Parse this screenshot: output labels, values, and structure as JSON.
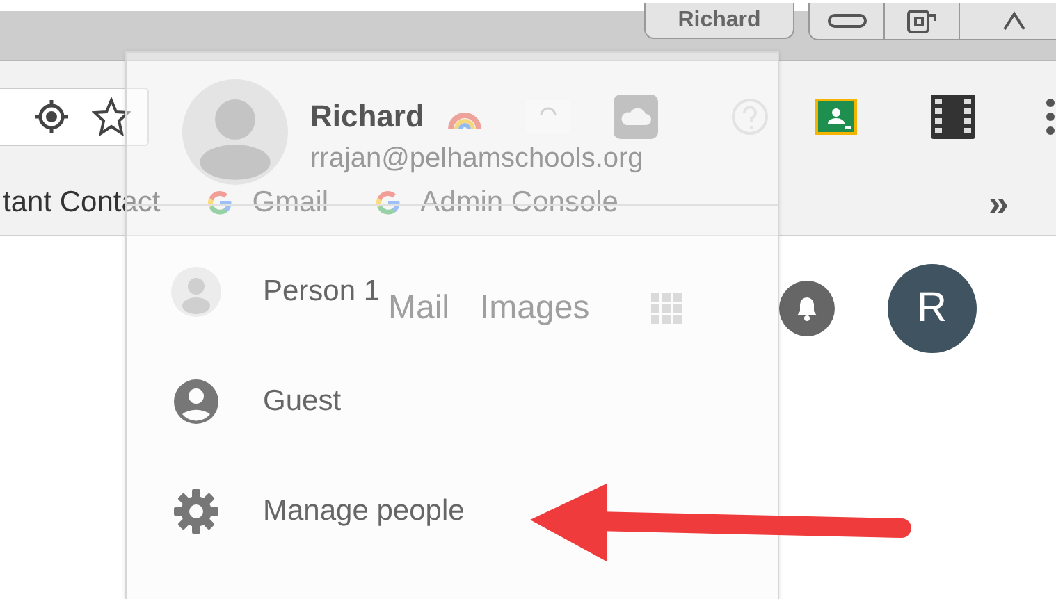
{
  "window": {
    "profile_button": "Richard"
  },
  "bookmarks": [
    {
      "kind": "plain",
      "label": "tant Contact"
    },
    {
      "kind": "google",
      "label": "Gmail"
    },
    {
      "kind": "google",
      "label": "Admin Console"
    }
  ],
  "bookmarks_overflow": "»",
  "page": {
    "links": [
      "Mail",
      "Images"
    ],
    "avatar_letter": "R"
  },
  "profile_menu": {
    "name": "Richard",
    "email": "rrajan@pelhamschools.org",
    "items": [
      {
        "kind": "person",
        "label": "Person 1"
      },
      {
        "kind": "guest",
        "label": "Guest"
      },
      {
        "kind": "manage",
        "label": "Manage people"
      }
    ]
  }
}
